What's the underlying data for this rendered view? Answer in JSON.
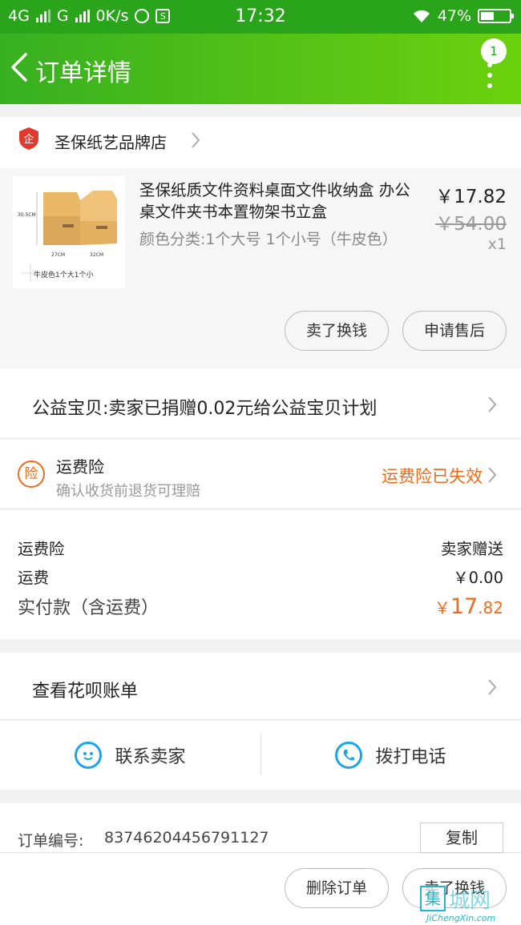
{
  "status_bar": {
    "network1": "4G",
    "network2": "G",
    "speed": "0K/s",
    "time": "17:32",
    "battery": "47%",
    "battery_level": 0.47
  },
  "header": {
    "title": "订单详情",
    "badge_count": "1"
  },
  "shop": {
    "name": "圣保纸艺品牌店"
  },
  "product": {
    "title": "圣保纸质文件资料桌面文件收纳盒 办公桌文件夹书本置物架书立盒",
    "sku": "颜色分类:1个大号 1个小号（牛皮色）",
    "price": "￥17.82",
    "original_price": "￥54.00",
    "quantity": "x1",
    "thumb_dim_height": "30.5CM",
    "thumb_dim_width": "27CM",
    "thumb_dim_depth": "32CM",
    "thumb_caption": "牛皮色1个大1个小",
    "btn_sell": "卖了换钱",
    "btn_aftersale": "申请售后"
  },
  "charity": {
    "text": "公益宝贝:卖家已捐赠0.02元给公益宝贝计划"
  },
  "insurance": {
    "icon_char": "险",
    "title": "运费险",
    "subtitle": "确认收货前退货可理赔",
    "status": "运费险已失效"
  },
  "fees": {
    "insurance_label": "运费险",
    "insurance_value": "卖家赠送",
    "shipping_label": "运费",
    "shipping_value": "￥0.00",
    "total_label": "实付款（含运费）",
    "total_currency": "￥",
    "total_int": "17",
    "total_dec": ".82"
  },
  "bill": {
    "text": "查看花呗账单"
  },
  "contact": {
    "seller_label": "联系卖家",
    "phone_label": "拨打电话"
  },
  "order": {
    "number_label": "订单编号:",
    "number": "83746204456791127",
    "copy_label": "复制"
  },
  "bottom": {
    "delete_label": "删除订单",
    "sell_label": "卖了换钱"
  },
  "watermark": {
    "box_char": "集",
    "text": "城网",
    "site": "JiChengXin.com"
  },
  "colors": {
    "brand_green": "#2aa41a",
    "accent_orange": "#f06a1a",
    "contact_blue": "#1aa5e8"
  }
}
